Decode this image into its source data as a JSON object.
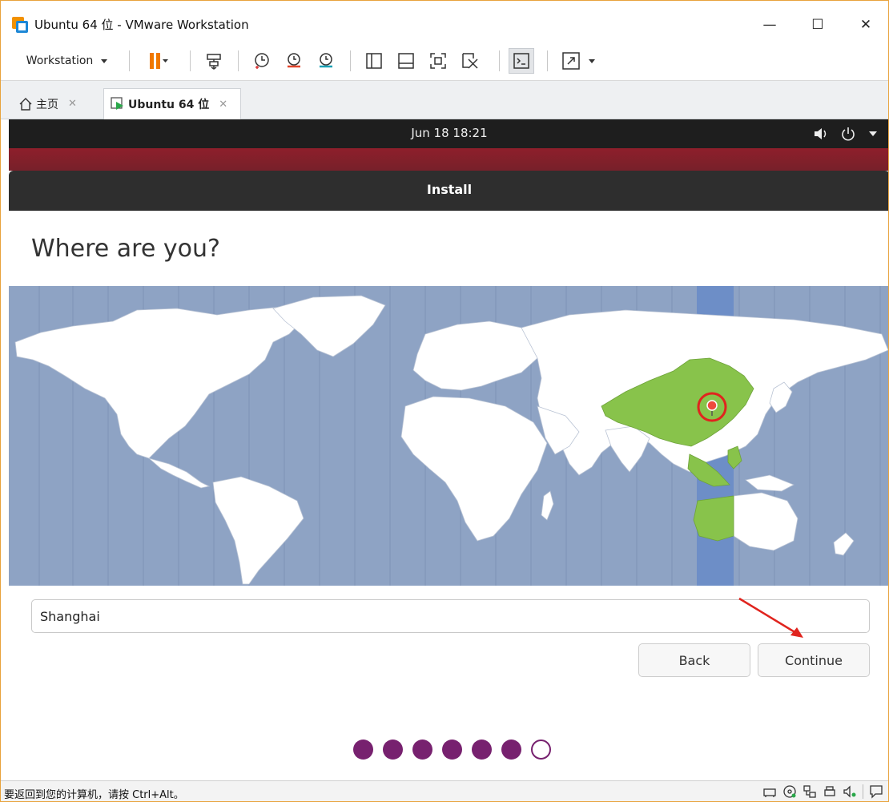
{
  "window": {
    "title": "Ubuntu 64 位 - VMware Workstation",
    "minimize": "—",
    "maximize": "☐",
    "close": "✕"
  },
  "toolbar": {
    "menu_label": "Workstation",
    "icons": [
      "pause-icon",
      "send-ctrl-alt-del-icon",
      "snapshot-icon",
      "revert-snapshot-icon",
      "snapshot-manager-icon",
      "show-library-icon",
      "thumbnail-bar-icon",
      "full-screen-icon",
      "unity-icon",
      "console-view-icon",
      "stretch-icon"
    ]
  },
  "tabs": [
    {
      "label": "主页",
      "close": "✕"
    },
    {
      "label": "Ubuntu 64 位",
      "close": "✕"
    }
  ],
  "ubuntu": {
    "clock": "Jun 18  18:21",
    "dialog_title": "Install",
    "heading": "Where are you?",
    "timezone_value": "Shanghai",
    "back_label": "Back",
    "continue_label": "Continue",
    "progress": {
      "total": 7,
      "completed": 6
    }
  },
  "colors": {
    "aubergine": "#77216f",
    "map_ocean": "#8ea3c4",
    "selected_zone": "#6d8ec7",
    "selected_country": "#88c34b",
    "annotation_red": "#e0241e"
  },
  "statusbar": {
    "hint": "要返回到您的计算机，请按 Ctrl+Alt。"
  }
}
